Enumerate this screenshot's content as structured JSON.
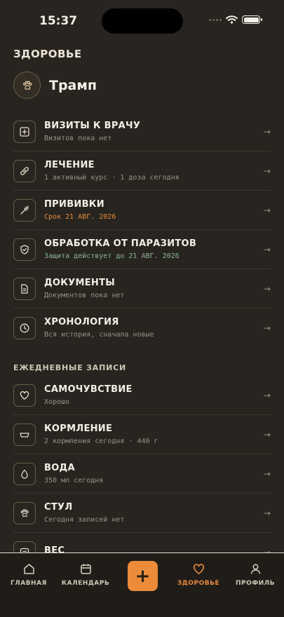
{
  "status": {
    "time": "15:37"
  },
  "header": {
    "title": "ЗДОРОВЬЕ",
    "pet_name": "Трамп"
  },
  "health_items": [
    {
      "title": "ВИЗИТЫ К ВРАЧУ",
      "subtitle": "Визитов пока нет",
      "icon": "plus-square-icon"
    },
    {
      "title": "ЛЕЧЕНИЕ",
      "subtitle": "1 активный курс · 1 доза сегодня",
      "icon": "pill-icon"
    },
    {
      "title": "ПРИВИВКИ",
      "subtitle": "Срок 21 АВГ. 2026",
      "icon": "syringe-icon"
    },
    {
      "title": "ОБРАБОТКА ОТ ПАРАЗИТОВ",
      "subtitle": "Защита действует до 21 АВГ. 2026",
      "icon": "shield-check-icon"
    },
    {
      "title": "ДОКУМЕНТЫ",
      "subtitle": "Документов пока нет",
      "icon": "document-icon"
    },
    {
      "title": "ХРОНОЛОГИЯ",
      "subtitle": "Вся история, сначала новые",
      "icon": "clock-icon"
    }
  ],
  "daily_section": {
    "label": "ЕЖЕДНЕВНЫЕ ЗАПИСИ"
  },
  "daily_items": [
    {
      "title": "САМОЧУВСТВИЕ",
      "subtitle": "Хорошо",
      "icon": "heart-icon"
    },
    {
      "title": "КОРМЛЕНИЕ",
      "subtitle": "2 кормления сегодня · 440 г",
      "icon": "bowl-icon"
    },
    {
      "title": "ВОДА",
      "subtitle": "350 мл сегодня",
      "icon": "water-drop-icon"
    },
    {
      "title": "СТУЛ",
      "subtitle": "Сегодня записей нет",
      "icon": "paw-icon"
    },
    {
      "title": "ВЕС",
      "subtitle": "",
      "icon": "scale-icon"
    }
  ],
  "arrow_glyph": "→",
  "tabbar": {
    "home": "ГЛАВНАЯ",
    "calendar": "КАЛЕНДАРЬ",
    "add": "+",
    "health": "ЗДОРОВЬЕ",
    "profile": "ПРОФИЛЬ",
    "active": "health"
  },
  "colors": {
    "accent": "#ec8b3a",
    "background": "#282520",
    "green_status": "#8fb59a"
  }
}
